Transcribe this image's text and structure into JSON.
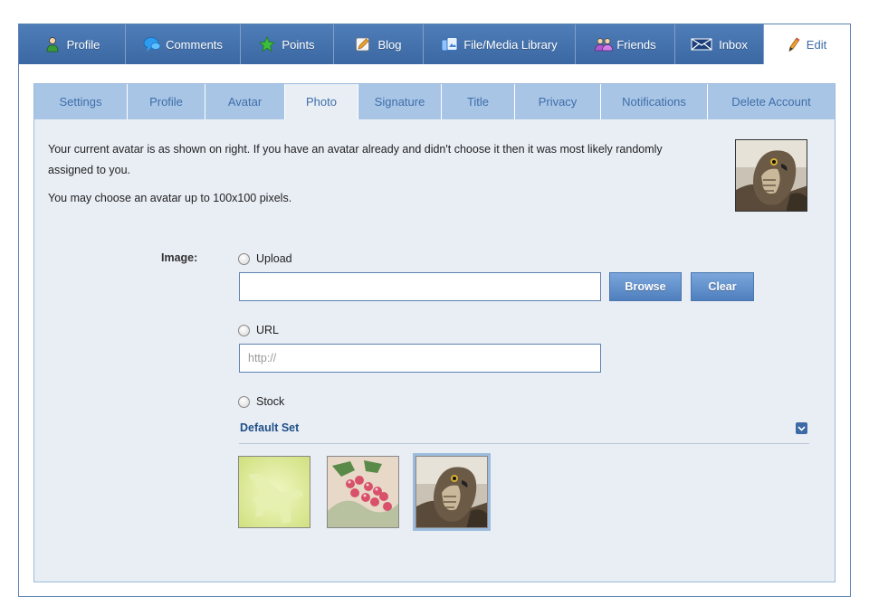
{
  "main_tabs": [
    {
      "label": "Profile",
      "icon": "user-icon"
    },
    {
      "label": "Comments",
      "icon": "speech-bubble-icon"
    },
    {
      "label": "Points",
      "icon": "star-icon"
    },
    {
      "label": "Blog",
      "icon": "pencil-note-icon"
    },
    {
      "label": "File/Media Library",
      "icon": "media-library-icon"
    },
    {
      "label": "Friends",
      "icon": "friends-icon"
    },
    {
      "label": "Inbox",
      "icon": "envelope-icon"
    },
    {
      "label": "Edit",
      "icon": "edit-pencil-icon",
      "active": true
    }
  ],
  "sub_tabs": [
    {
      "label": "Settings"
    },
    {
      "label": "Profile"
    },
    {
      "label": "Avatar"
    },
    {
      "label": "Photo",
      "active": true
    },
    {
      "label": "Signature"
    },
    {
      "label": "Title"
    },
    {
      "label": "Privacy"
    },
    {
      "label": "Notifications"
    },
    {
      "label": "Delete Account"
    }
  ],
  "intro": {
    "line1": "Your current avatar is as shown on right. If you have an avatar already and didn't choose it then it was most likely randomly assigned to you.",
    "line2": "You may choose an avatar up to 100x100 pixels."
  },
  "form": {
    "image_label": "Image:",
    "upload_label": "Upload",
    "upload_value": "",
    "browse_label": "Browse",
    "clear_label": "Clear",
    "url_label": "URL",
    "url_placeholder": "http://",
    "stock_label": "Stock"
  },
  "stock_set": {
    "title": "Default Set",
    "thumbnails": [
      {
        "name": "airplane-thumbnail",
        "selected": false
      },
      {
        "name": "berries-thumbnail",
        "selected": false
      },
      {
        "name": "hawk-thumbnail",
        "selected": true
      }
    ]
  },
  "colors": {
    "accent": "#3c6aa6",
    "subtab_bg": "#a9c5e6",
    "panel_bg": "#e9eef5"
  }
}
